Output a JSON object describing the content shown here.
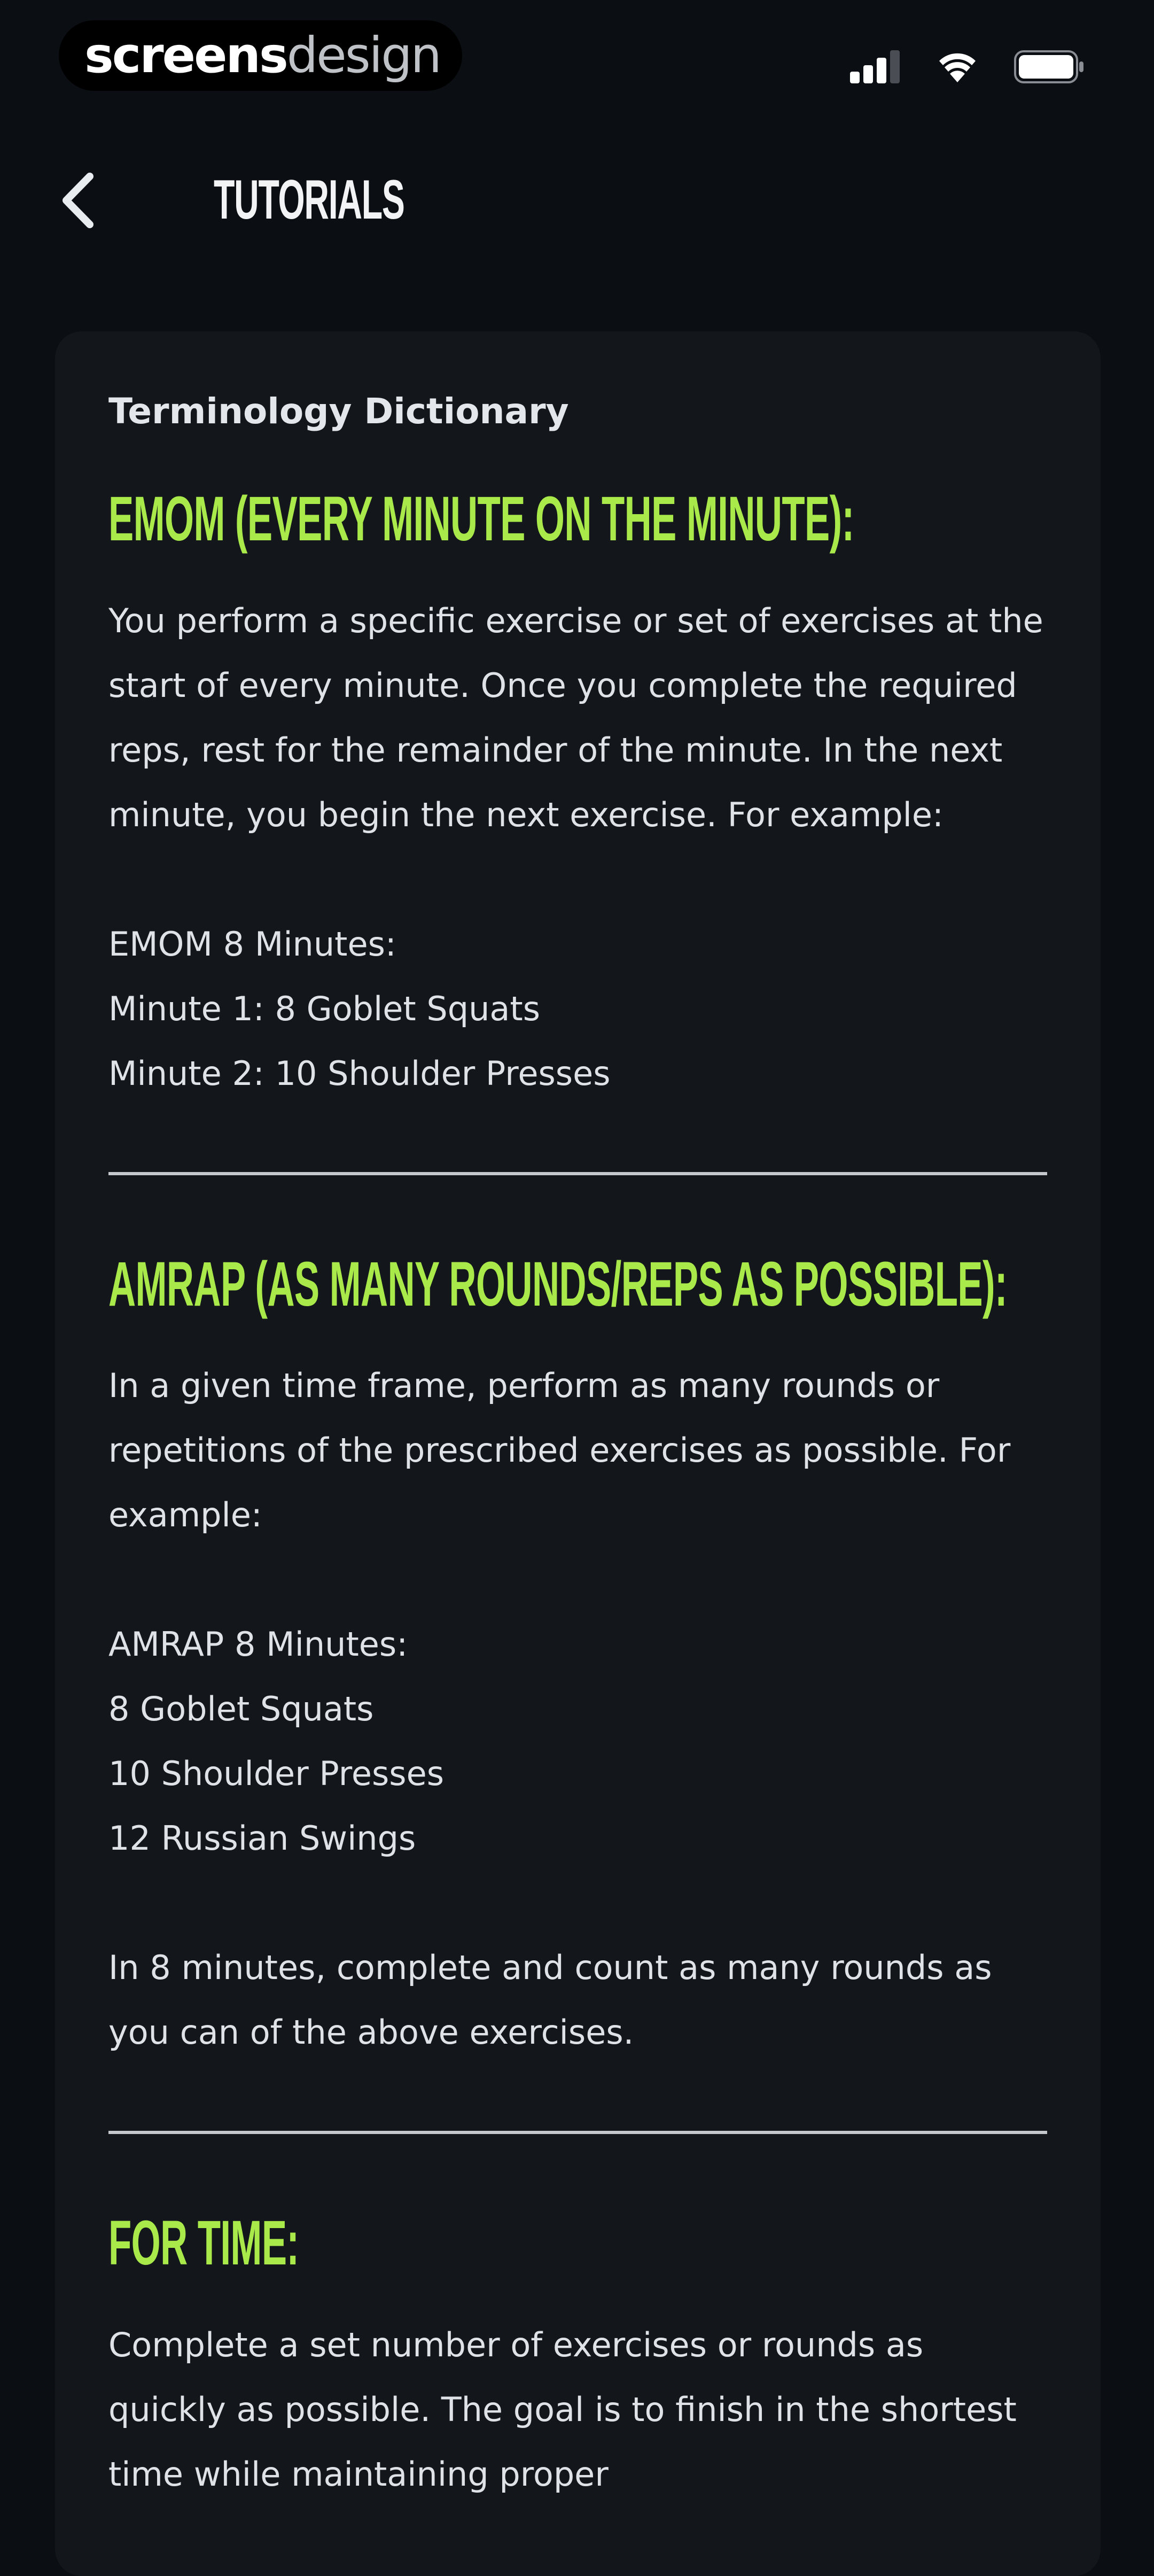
{
  "status_bar": {
    "brand_bold": "screens",
    "brand_light": "design",
    "icons": [
      "signal-icon",
      "wifi-icon",
      "battery-icon"
    ]
  },
  "nav": {
    "back_icon": "chevron-left-icon",
    "title": "TUTORIALS"
  },
  "card": {
    "title": "Terminology Dictionary",
    "sections": [
      {
        "heading": "EMOM (EVERY MINUTE ON THE MINUTE):",
        "body": [
          "You perform a specific exercise or set of exercises at the start of every minute. Once you complete the required reps, rest for the remainder of the minute. In the next minute, you begin the next exercise. For example:",
          "",
          "EMOM 8 Minutes:",
          "Minute 1: 8 Goblet Squats",
          "Minute 2: 10 Shoulder Presses"
        ]
      },
      {
        "heading": "AMRAP (AS MANY ROUNDS/REPS AS POSSIBLE):",
        "body": [
          "In a given time frame, perform as many rounds or repetitions of the prescribed exercises as possible. For example:",
          "",
          "AMRAP 8 Minutes:",
          "8 Goblet Squats",
          "10 Shoulder Presses",
          "12 Russian Swings",
          "",
          "In 8 minutes, complete and count as many rounds as you can of the above exercises."
        ]
      },
      {
        "heading": "FOR TIME:",
        "body": [
          "Complete a set number of exercises or rounds as quickly as possible. The goal is to finish in the shortest time while maintaining proper"
        ]
      }
    ]
  },
  "colors": {
    "background": "#0b0e12",
    "card": "#13171c",
    "accent": "#a9ea4a",
    "text": "#dfe3e7"
  }
}
